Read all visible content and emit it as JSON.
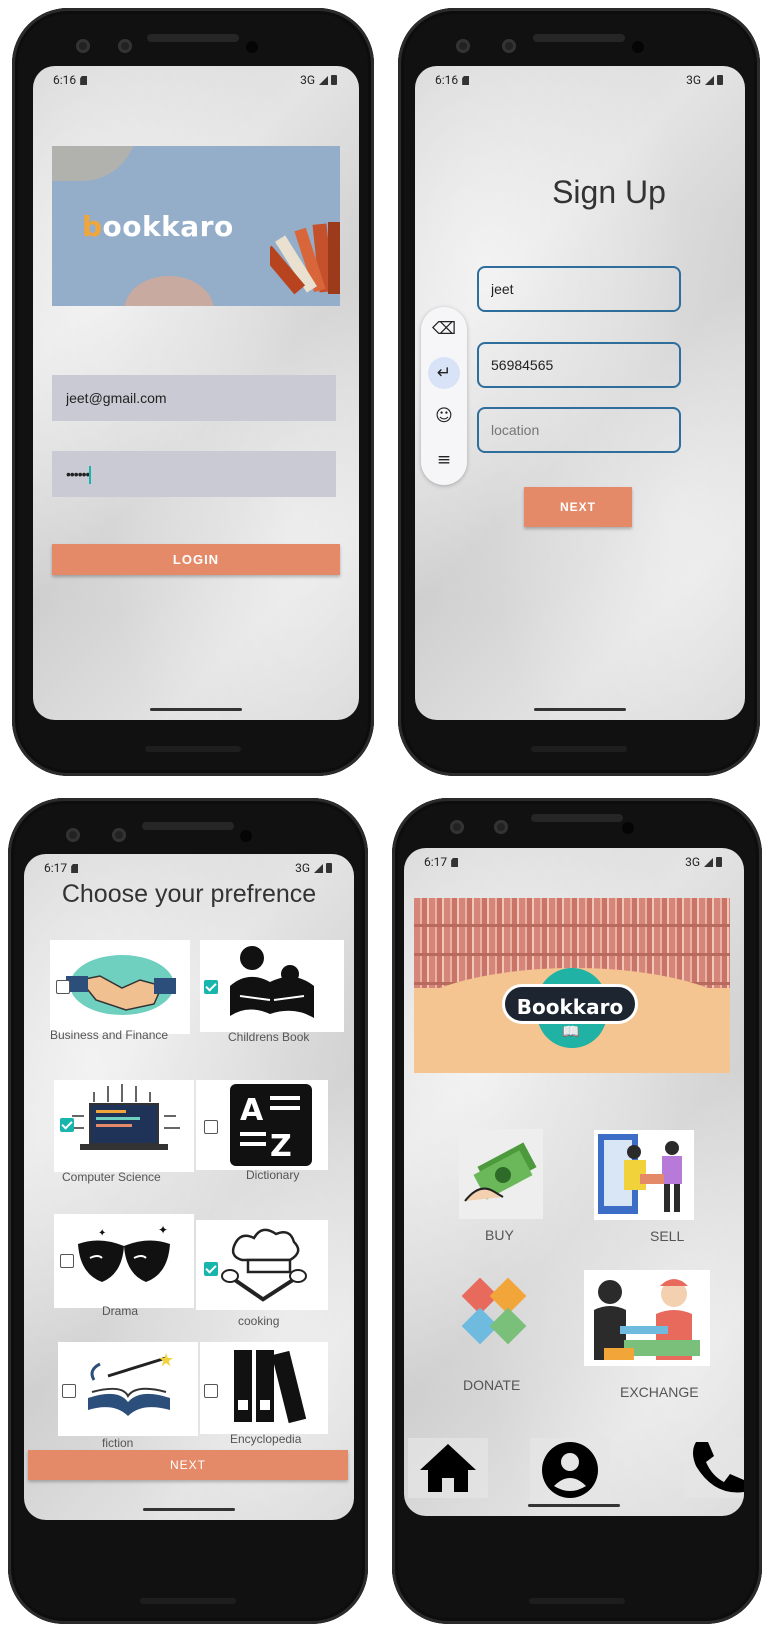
{
  "login": {
    "status_time": "6:16",
    "status_net": "3G",
    "logo_first": "b",
    "logo_rest": "ookkaro",
    "email_value": "jeet@gmail.com",
    "password_value": "••••••",
    "login_label": "LOGIN"
  },
  "signup": {
    "status_time": "6:16",
    "status_net": "3G",
    "title": "Sign Up",
    "name_value": "jeet",
    "phone_value": "56984565",
    "location_placeholder": "location",
    "next_label": "NEXT",
    "keyboard_tools": [
      "backspace-icon",
      "enter-icon",
      "emoji-icon",
      "menu-icon"
    ]
  },
  "preference": {
    "status_time": "6:17",
    "status_net": "3G",
    "title": "Choose your prefrence",
    "categories": [
      {
        "label": "Business and Finance",
        "checked": false
      },
      {
        "label": "Childrens Book",
        "checked": true
      },
      {
        "label": "Computer Science",
        "checked": true
      },
      {
        "label": "Dictionary",
        "checked": false
      },
      {
        "label": "Drama",
        "checked": false
      },
      {
        "label": "cooking",
        "checked": true
      },
      {
        "label": "fiction",
        "checked": false
      },
      {
        "label": "Encyclopedia",
        "checked": false
      }
    ],
    "next_label": "NEXT"
  },
  "home": {
    "status_time": "6:17",
    "status_net": "3G",
    "logo": "Bookkaro",
    "tiles": {
      "buy": "BUY",
      "sell": "SELL",
      "donate": "DONATE",
      "exchange": "EXCHANGE"
    },
    "nav": [
      "home-icon",
      "profile-icon",
      "phone-icon"
    ]
  },
  "colors": {
    "accent": "#e58a68",
    "check": "#18b5ad",
    "field_border": "#2e6e9c"
  }
}
